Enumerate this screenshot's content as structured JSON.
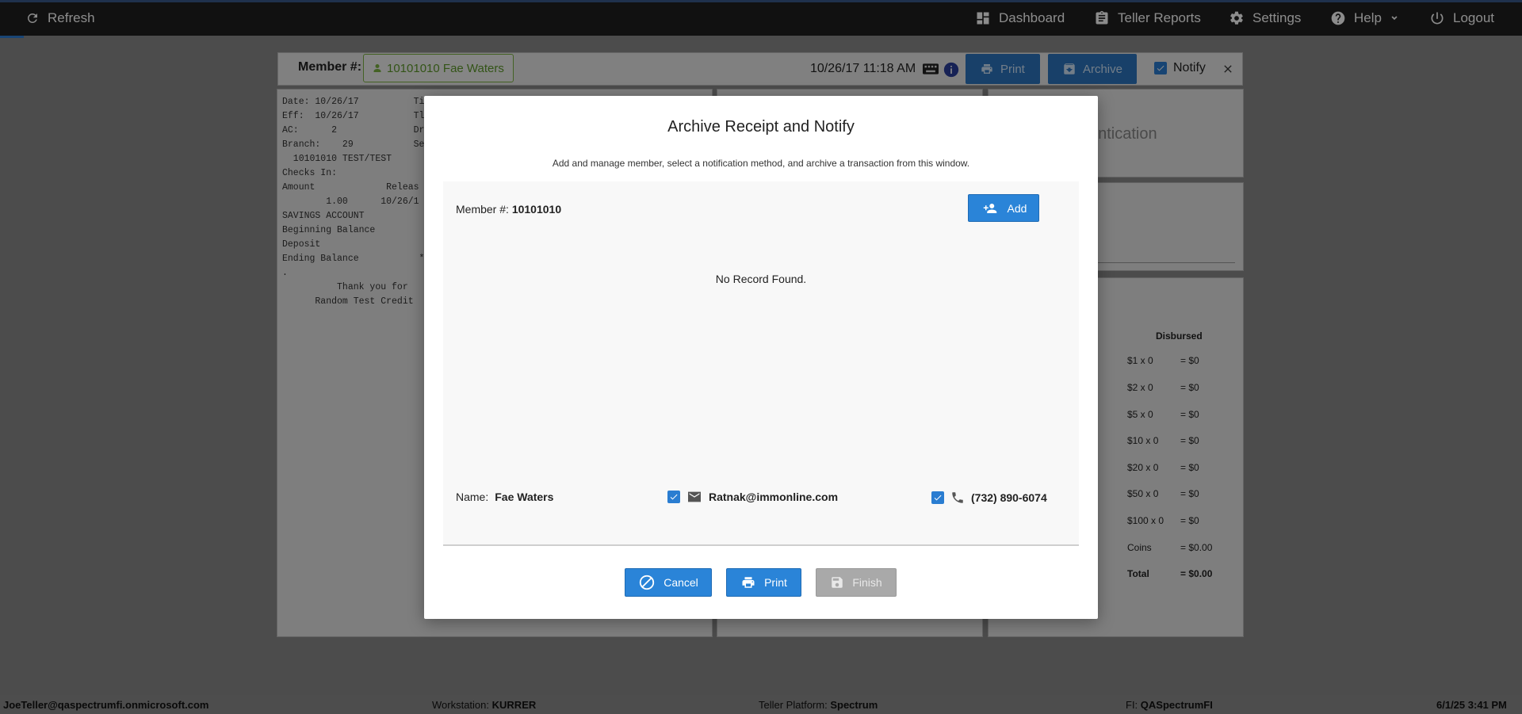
{
  "topnav": {
    "refresh": "Refresh",
    "dashboard": "Dashboard",
    "teller_reports": "Teller Reports",
    "settings": "Settings",
    "help": "Help",
    "logout": "Logout"
  },
  "header": {
    "member_label": "Member #:",
    "member_badge": "10101010 Fae Waters",
    "datetime": "10/26/17 11:18 AM",
    "print": "Print",
    "archive": "Archive",
    "notify": "Notify"
  },
  "receipt": {
    "lines": [
      "Date: 10/26/17          Ti",
      "Eff:  10/26/17          Tl",
      "AC:      2              Dr",
      "Branch:    29           Se",
      "  10101010 TEST/TEST",
      "",
      "Checks In:",
      "Amount             Releas",
      "        1.00      10/26/1",
      "",
      "",
      "SAVINGS ACCOUNT",
      "Beginning Balance",
      "Deposit",
      "Ending Balance           *",
      "",
      "",
      ".",
      "",
      "          Thank you for",
      "      Random Test Credit"
    ]
  },
  "auth_panel": {
    "text": "entication"
  },
  "cash": {
    "header": "Disbursed",
    "rows": [
      {
        "label": "$1 x 0",
        "value": "= $0"
      },
      {
        "label": "$2 x 0",
        "value": "= $0"
      },
      {
        "label": "$5 x 0",
        "value": "= $0"
      },
      {
        "label": "$10 x 0",
        "value": "= $0"
      },
      {
        "label": "$20 x 0",
        "value": "= $0"
      },
      {
        "label": "$50 x 0",
        "value": "= $0"
      },
      {
        "label": "$100 x 0",
        "value": "= $0"
      },
      {
        "label": "Coins",
        "value": "= $0.00"
      },
      {
        "label": "Total",
        "value": "= $0.00"
      }
    ]
  },
  "modal": {
    "title": "Archive Receipt and Notify",
    "subtitle": "Add and manage member, select a notification method, and archive a transaction from this window.",
    "member_label": "Member #:",
    "member_value": "10101010",
    "add": "Add",
    "no_record": "No Record Found.",
    "name_label": "Name:",
    "name_value": "Fae Waters",
    "email": "Ratnak@immonline.com",
    "phone": "(732) 890-6074",
    "cancel": "Cancel",
    "print": "Print",
    "finish": "Finish"
  },
  "footer": {
    "user": "JoeTeller@qaspectrumfi.onmicrosoft.com",
    "workstation_label": "Workstation:",
    "workstation_value": "KURRER",
    "platform_label": "Teller Platform:",
    "platform_value": "Spectrum",
    "fi_label": "FI:",
    "fi_value": "QASpectrumFI",
    "datetime": "6/1/25 3:41 PM"
  }
}
